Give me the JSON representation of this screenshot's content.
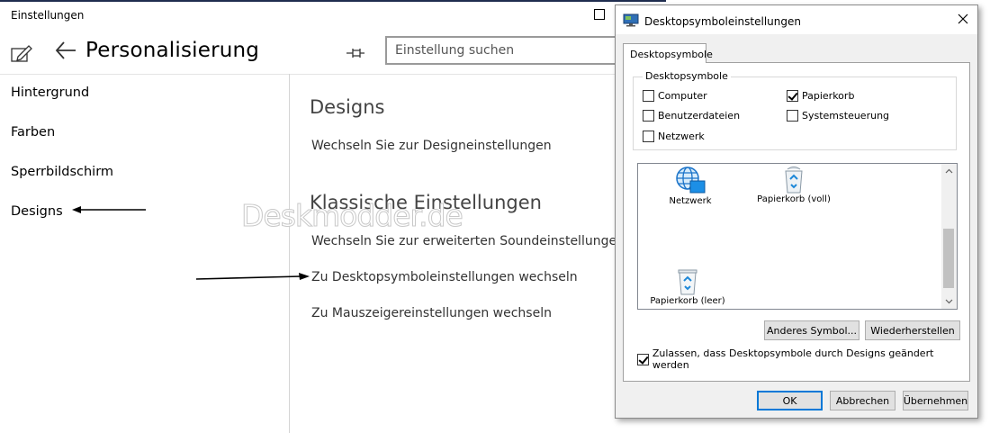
{
  "settings": {
    "window_title": "Einstellungen",
    "page_title": "Personalisierung",
    "search_placeholder": "Einstellung suchen",
    "nav": [
      "Hintergrund",
      "Farben",
      "Sperrbildschirm",
      "Designs"
    ],
    "sections": [
      {
        "heading": "Designs",
        "links": [
          "Wechseln Sie zur Designeinstellungen"
        ]
      },
      {
        "heading": "Klassische Einstellungen",
        "links": [
          "Wechseln Sie zur erweiterten Soundeinstellungen",
          "Zu Desktopsymboleinstellungen wechseln",
          "Zu Mauszeigereinstellungen wechseln"
        ]
      }
    ],
    "watermark": "Deskmodder.de"
  },
  "dialog": {
    "title": "Desktopsymboleinstellungen",
    "tab": "Desktopsymbole",
    "group_label": "Desktopsymbole",
    "checkboxes": [
      {
        "label": "Computer",
        "checked": false
      },
      {
        "label": "Papierkorb",
        "checked": true
      },
      {
        "label": "Benutzerdateien",
        "checked": false
      },
      {
        "label": "Systemsteuerung",
        "checked": false
      },
      {
        "label": "Netzwerk",
        "checked": false
      }
    ],
    "icons": [
      "Netzwerk",
      "Papierkorb (voll)",
      "Papierkorb (leer)"
    ],
    "buttons": {
      "change_icon": "Anderes Symbol...",
      "restore": "Wiederherstellen",
      "ok": "OK",
      "cancel": "Abbrechen",
      "apply": "Übernehmen"
    },
    "allow_themes": {
      "label": "Zulassen, dass Desktopsymbole durch Designs geändert werden",
      "checked": true
    }
  },
  "colors": {
    "accent": "#0078d7",
    "title_bar_line": "#1f2d4f"
  }
}
